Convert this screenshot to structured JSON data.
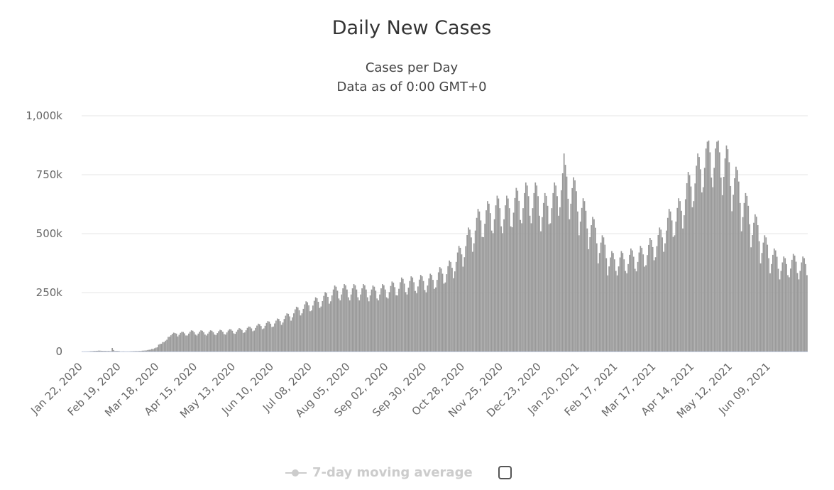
{
  "chart_data": {
    "type": "bar",
    "title": "Daily New Cases",
    "subtitle_lines": [
      "Cases per Day",
      "Data as of 0:00 GMT+0"
    ],
    "xlabel": "",
    "ylabel": "",
    "x_start": "Jan 22, 2020",
    "x_step": "1 day",
    "x_tick_labels": [
      "Jan 22, 2020",
      "Feb 19, 2020",
      "Mar 18, 2020",
      "Apr 15, 2020",
      "May 13, 2020",
      "Jun 10, 2020",
      "Jul 08, 2020",
      "Aug 05, 2020",
      "Sep 02, 2020",
      "Sep 30, 2020",
      "Oct 28, 2020",
      "Nov 25, 2020",
      "Dec 23, 2020",
      "Jan 20, 2021",
      "Feb 17, 2021",
      "Mar 17, 2021",
      "Apr 14, 2021",
      "May 12, 2021",
      "Jun 09, 2021"
    ],
    "x_tick_every_days": 28,
    "y_ticks": [
      0,
      250,
      500,
      750,
      1000
    ],
    "y_tick_labels": [
      "0",
      "250k",
      "500k",
      "750k",
      "1,000k"
    ],
    "ylim": [
      0,
      1000
    ],
    "y_unit": "k",
    "grid": true,
    "bar_color": "#999999",
    "values": [
      0.6,
      0.3,
      0.6,
      0.5,
      0.7,
      0.8,
      1.4,
      1.7,
      2.1,
      2.6,
      2.8,
      3.2,
      3.9,
      3.7,
      3.2,
      2.6,
      2.8,
      2.5,
      2.1,
      2.6,
      2.0,
      2.0,
      15.1,
      6.5,
      2.1,
      2.5,
      2.1,
      2.0,
      0.5,
      0.6,
      1.0,
      0.6,
      0.6,
      0.6,
      0.6,
      0.9,
      1.2,
      1.3,
      1.8,
      1.9,
      1.8,
      2.2,
      2.3,
      2.5,
      3.6,
      3.9,
      4.5,
      4.5,
      6.4,
      7.5,
      8.0,
      10.9,
      10.3,
      13.8,
      16.5,
      17.8,
      29,
      32,
      33,
      40,
      40,
      46,
      50,
      62,
      63,
      69,
      75,
      80,
      78,
      76,
      64,
      71,
      79,
      84,
      83,
      77,
      68,
      68,
      76,
      84,
      90,
      88,
      82,
      72,
      68,
      76,
      84,
      90,
      88,
      82,
      72,
      68,
      76,
      84,
      90,
      88,
      82,
      72,
      70,
      78,
      86,
      92,
      90,
      84,
      74,
      72,
      81,
      89,
      95,
      94,
      88,
      77,
      75,
      84,
      92,
      99,
      97,
      91,
      79,
      81,
      90,
      100,
      106,
      105,
      98,
      86,
      89,
      100,
      110,
      118,
      116,
      108,
      95,
      98,
      109,
      121,
      129,
      127,
      118,
      104,
      106,
      119,
      131,
      140,
      138,
      129,
      113,
      123,
      138,
      152,
      162,
      160,
      149,
      131,
      145,
      162,
      179,
      190,
      187,
      175,
      153,
      162,
      181,
      200,
      213,
      209,
      196,
      171,
      174,
      195,
      215,
      230,
      226,
      211,
      185,
      191,
      214,
      236,
      252,
      248,
      232,
      203,
      213,
      238,
      263,
      280,
      275,
      258,
      225,
      217,
      242,
      268,
      286,
      281,
      263,
      230,
      217,
      242,
      268,
      286,
      281,
      263,
      230,
      217,
      242,
      268,
      286,
      281,
      263,
      230,
      213,
      238,
      263,
      280,
      275,
      258,
      225,
      217,
      242,
      268,
      286,
      281,
      263,
      230,
      225,
      252,
      278,
      297,
      292,
      273,
      239,
      238,
      266,
      294,
      314,
      308,
      288,
      252,
      242,
      271,
      299,
      319,
      314,
      294,
      257,
      247,
      276,
      305,
      325,
      319,
      299,
      261,
      251,
      280,
      310,
      330,
      325,
      304,
      266,
      272,
      304,
      336,
      358,
      352,
      330,
      288,
      293,
      328,
      362,
      386,
      380,
      355,
      311,
      340,
      380,
      420,
      448,
      440,
      412,
      360,
      400,
      447,
      494,
      526,
      517,
      484,
      423,
      459,
      513,
      567,
      605,
      594,
      556,
      486,
      485,
      542,
      599,
      638,
      627,
      587,
      513,
      502,
      561,
      620,
      661,
      649,
      608,
      531,
      502,
      561,
      620,
      661,
      649,
      608,
      531,
      527,
      589,
      651,
      694,
      682,
      639,
      558,
      544,
      608,
      672,
      717,
      704,
      659,
      576,
      544,
      608,
      672,
      717,
      704,
      659,
      576,
      510,
      570,
      630,
      672,
      660,
      618,
      540,
      544,
      608,
      672,
      717,
      704,
      659,
      576,
      612,
      684,
      756,
      840,
      792,
      742,
      648,
      561,
      627,
      693,
      739,
      726,
      680,
      594,
      493,
      551,
      609,
      650,
      638,
      597,
      522,
      434,
      485,
      536,
      571,
      561,
      525,
      459,
      374,
      418,
      462,
      493,
      484,
      453,
      396,
      323,
      361,
      399,
      426,
      418,
      391,
      342,
      323,
      361,
      399,
      426,
      418,
      391,
      342,
      332,
      371,
      410,
      437,
      429,
      402,
      351,
      340,
      380,
      420,
      448,
      440,
      412,
      360,
      366,
      409,
      452,
      482,
      473,
      443,
      387,
      400,
      447,
      494,
      526,
      517,
      484,
      423,
      459,
      513,
      567,
      605,
      594,
      556,
      486,
      493,
      551,
      609,
      650,
      638,
      597,
      522,
      578,
      646,
      714,
      762,
      748,
      700,
      612,
      638,
      713,
      788,
      840,
      825,
      773,
      675,
      697,
      779,
      861,
      890,
      895,
      845,
      738,
      697,
      779,
      861,
      890,
      895,
      845,
      738,
      663,
      741,
      819,
      874,
      858,
      803,
      702,
      595,
      665,
      735,
      784,
      770,
      721,
      630,
      510,
      570,
      630,
      672,
      660,
      618,
      540,
      442,
      494,
      546,
      582,
      572,
      536,
      468,
      374,
      418,
      462,
      493,
      484,
      453,
      396,
      332,
      371,
      410,
      437,
      429,
      402,
      351,
      306,
      342,
      378,
      403,
      396,
      371,
      324,
      315,
      352,
      389,
      414,
      407,
      381,
      333,
      306,
      342,
      378,
      403,
      396,
      371,
      324
    ]
  },
  "legend": {
    "label": "7-day moving average",
    "enabled": false,
    "icon": "line-marker-icon",
    "color": "#cccccc"
  }
}
